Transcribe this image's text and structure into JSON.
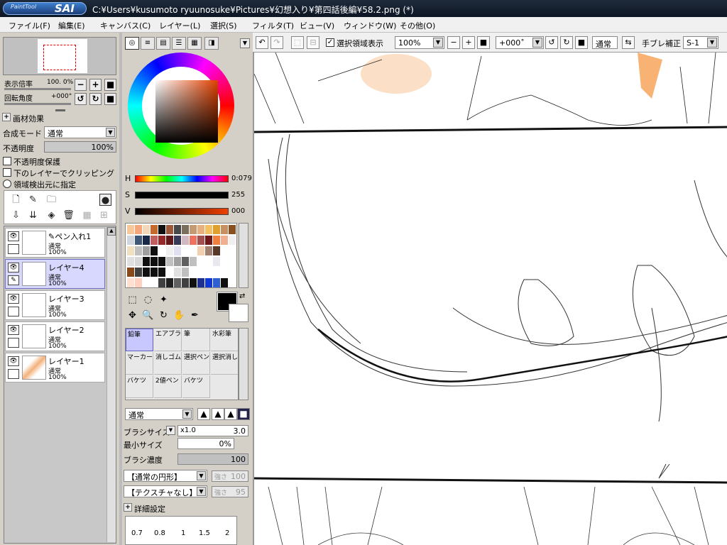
{
  "app": {
    "logo_sub": "PaintTool",
    "logo_main": "SAI",
    "window_title": "C:¥Users¥kusumoto ryuunosuke¥Pictures¥幻想入り¥第四話後編¥58.2.png (*)"
  },
  "menu": [
    "ファイル(F)",
    "編集(E)",
    "キャンバス(C)",
    "レイヤー(L)",
    "選択(S)",
    "フィルタ(T)",
    "ビュー(V)",
    "ウィンドウ(W)",
    "その他(O)"
  ],
  "navigator": {
    "zoom_label": "表示倍率",
    "zoom_value": "100. 0%",
    "rotate_label": "回転角度",
    "rotate_value": "+000°"
  },
  "layer_settings": {
    "effects_label": "画材効果",
    "blend_label": "合成モード",
    "blend_value": "通常",
    "opacity_label": "不透明度",
    "opacity_value": "100%",
    "opacity_fraction": 1.0,
    "protect_label": "不透明度保護",
    "clip_label": "下のレイヤーでクリッピング",
    "source_label": "領域検出元に指定"
  },
  "layers": [
    {
      "name": "ペン入れ1",
      "mode": "通常",
      "opacity": "100%",
      "selected": false,
      "has_pen_icon": true
    },
    {
      "name": "レイヤー4",
      "mode": "通常",
      "opacity": "100%",
      "selected": true,
      "has_pen_icon": false
    },
    {
      "name": "レイヤー3",
      "mode": "通常",
      "opacity": "100%",
      "selected": false,
      "has_pen_icon": false
    },
    {
      "name": "レイヤー2",
      "mode": "通常",
      "opacity": "100%",
      "selected": false,
      "has_pen_icon": false
    },
    {
      "name": "レイヤー1",
      "mode": "通常",
      "opacity": "100%",
      "selected": false,
      "has_pen_icon": false
    }
  ],
  "color": {
    "h_label": "H",
    "h_value": "0:079",
    "s_label": "S",
    "s_value": "255",
    "v_label": "V",
    "v_value": "000",
    "main_color": "#000000",
    "sub_color": "#ffffff",
    "swatches": [
      "#f7c79a",
      "#f4a77a",
      "#f2d8b8",
      "#c56a2e",
      "#101010",
      "#9c5a3a",
      "#484848",
      "#7a6e5c",
      "#c59a72",
      "#e7b080",
      "#f5c060",
      "#e0a030",
      "#c89060",
      "#885020",
      "#cfd6e0",
      "#405878",
      "#182848",
      "#c06060",
      "#982828",
      "#601818",
      "#383858",
      "#d0b8c0",
      "#f07060",
      "#a05050",
      "#701818",
      "#f08040",
      "#f0b090",
      "#f0f0f0",
      "#f0e0c0",
      "#c0c0c0",
      "#a0a0a0",
      "#101010",
      "#ffffff",
      "#f0f0f0",
      "#e0e0f0",
      "#ffffff",
      "#ffffff",
      "#f0d0b0",
      "#a08070",
      "#583828",
      "#ffffff",
      "#ffffff",
      "#e0e0e0",
      "#d8d8d8",
      "#101010",
      "#101010",
      "#101010",
      "#c0c0c0",
      "#a0a0a0",
      "#606060",
      "#c0c0c0",
      "#ffffff",
      "#ffffff",
      "#e8e8f0",
      "#ffffff",
      "#ffffff",
      "#8a4818",
      "#404040",
      "#101010",
      "#101010",
      "#101010",
      "#ffffff",
      "#e0e0e0",
      "#c0c0c0",
      "#ffffff",
      "#ffffff",
      "#ffffff",
      "#ffffff",
      "#ffffff",
      "#ffffff",
      "#ffe0d0",
      "#ffd0c0",
      "#ffffff",
      "#ffffff",
      "#404040",
      "#202020",
      "#606060",
      "#404040",
      "#101010",
      "#203090",
      "#1038d8",
      "#3060d0",
      "#101010",
      "#ffffff"
    ]
  },
  "brushes": [
    {
      "label": "鉛筆",
      "selected": true
    },
    {
      "label": "エアブラシ",
      "selected": false
    },
    {
      "label": "筆",
      "selected": false
    },
    {
      "label": "水彩筆",
      "selected": false
    },
    {
      "label": "マーカー",
      "selected": false
    },
    {
      "label": "消しゴム",
      "selected": false
    },
    {
      "label": "選択ペン",
      "selected": false
    },
    {
      "label": "選択消し",
      "selected": false
    },
    {
      "label": "バケツ",
      "selected": false
    },
    {
      "label": "2値ペン",
      "selected": false
    },
    {
      "label": "バケツ",
      "selected": false
    }
  ],
  "brush_props": {
    "blend_value": "通常",
    "size_label": "ブラシサイズ",
    "size_mult": "x1.0",
    "size_value": "3.0",
    "min_size_label": "最小サイズ",
    "min_size_value": "0%",
    "density_label": "ブラシ濃度",
    "density_value": "100",
    "shape_value": "【通常の円形】",
    "shape_strength_label": "強さ",
    "shape_strength_value": "100",
    "texture_value": "【テクスチャなし】",
    "texture_strength_label": "強さ",
    "texture_strength_value": "95",
    "detail_label": "詳細設定",
    "grid_values": [
      "0.7",
      "0.8",
      "1",
      "1.5",
      "2"
    ]
  },
  "toolbar": {
    "selection_label": "選択領域表示",
    "selection_checked": true,
    "zoom_value": "100%",
    "angle_value": "+000˚",
    "mode_value": "通常",
    "stabilizer_label": "手ブレ補正",
    "stabilizer_value": "S-1"
  }
}
